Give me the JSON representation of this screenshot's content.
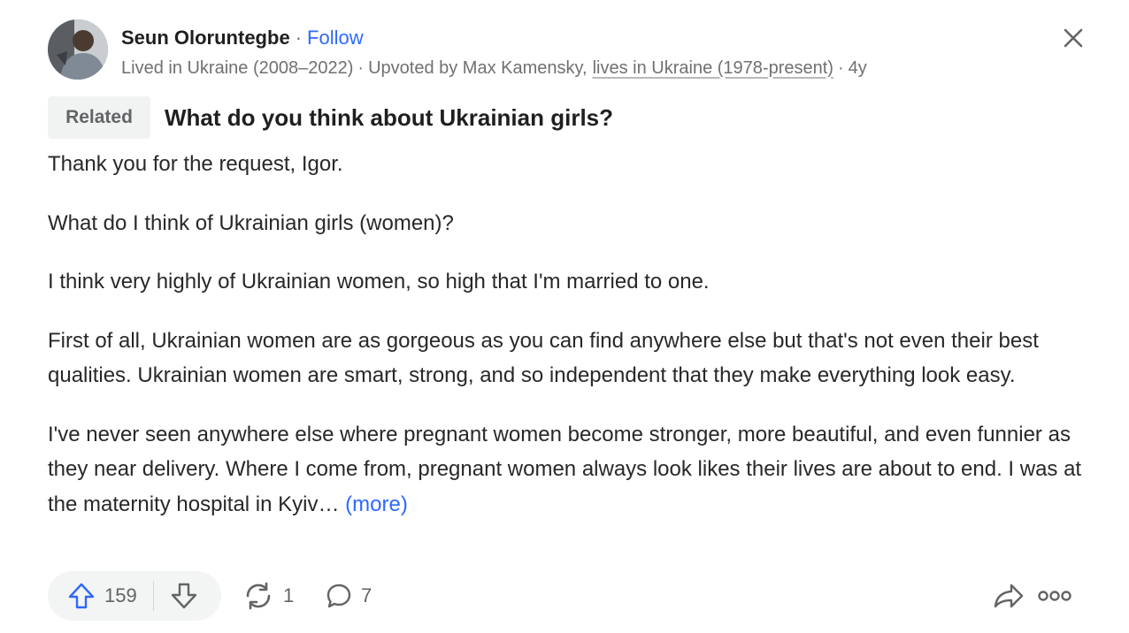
{
  "author": {
    "name": "Seun Oloruntegbe",
    "separator": "·",
    "follow_label": "Follow",
    "avatar_icon": "user-avatar-photo"
  },
  "meta": {
    "credential": "Lived in Ukraine (2008–2022)",
    "sep1": "·",
    "upvoted_by": "Upvoted by Max Kamensky,",
    "upvoter_credential": "lives in Ukraine (1978-present)",
    "sep2": "·",
    "age": "4y"
  },
  "related": {
    "badge": "Related",
    "question": "What do you think about Ukrainian girls?"
  },
  "answer": {
    "paragraphs": [
      "Thank you for the request, Igor.",
      "What do I think of Ukrainian girls (women)?",
      "I think very highly of Ukrainian women, so high that I'm married to one.",
      "First of all, Ukrainian women are as gorgeous as you can find anywhere else but that's not even their best qualities. Ukrainian women are smart, strong, and so independent that they make everything look easy.",
      "I've never seen anywhere else where pregnant women become stronger, more beautiful, and even funnier as they near delivery. Where I come from, pregnant women always look likes their lives are about to end. I was at the maternity hospital in Kyiv…"
    ],
    "more_label": "(more)"
  },
  "actions": {
    "upvotes": "159",
    "shares": "1",
    "comments": "7"
  },
  "icons": {
    "close": "close-icon",
    "upvote": "upvote-arrow-icon",
    "downvote": "downvote-arrow-icon",
    "share": "reshare-icon",
    "comment": "comment-bubble-icon",
    "forward": "forward-share-icon",
    "more": "more-options-icon"
  },
  "colors": {
    "link": "#2e69ff",
    "text": "#282829",
    "muted": "#6f7072",
    "pill_bg": "#f3f4f4"
  }
}
